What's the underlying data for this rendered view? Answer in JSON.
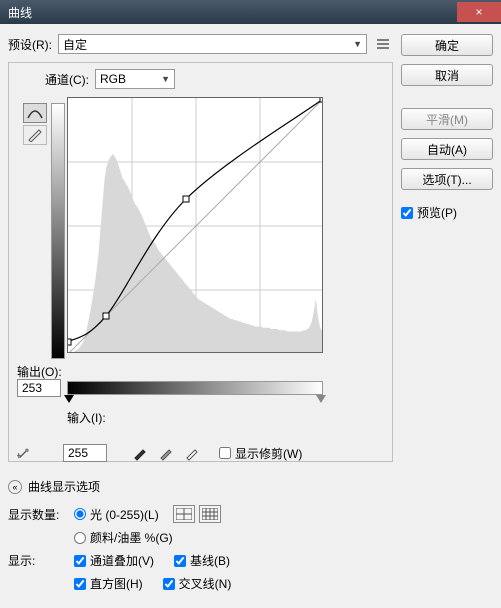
{
  "window": {
    "title": "曲线",
    "close_glyph": "×"
  },
  "buttons": {
    "ok": "确定",
    "cancel": "取消",
    "smooth": "平滑(M)",
    "auto": "自动(A)",
    "options": "选项(T)..."
  },
  "preview": {
    "label": "预览(P)",
    "checked": true
  },
  "preset": {
    "label": "预设(R):",
    "value": "自定"
  },
  "channel": {
    "label": "通道(C):",
    "value": "RGB"
  },
  "output": {
    "label": "输出(O):",
    "value": "253"
  },
  "input": {
    "label": "输入(I):",
    "value": "255"
  },
  "show_clipping": {
    "label": "显示修剪(W)",
    "checked": false
  },
  "disclosure": {
    "label": "曲线显示选项",
    "glyph": "⌃"
  },
  "display_amount": {
    "label": "显示数量:",
    "opt_light": "光 (0-255)(L)",
    "opt_pigment": "颜料/油墨 %(G)",
    "selected": "light"
  },
  "show": {
    "label": "显示:",
    "overlay": {
      "label": "通道叠加(V)",
      "checked": true
    },
    "baseline": {
      "label": "基线(B)",
      "checked": true
    },
    "histogram": {
      "label": "直方图(H)",
      "checked": true
    },
    "intersection": {
      "label": "交叉线(N)",
      "checked": true
    }
  },
  "chart_data": {
    "type": "line",
    "title": "",
    "xlabel": "输入",
    "ylabel": "输出",
    "xlim": [
      0,
      255
    ],
    "ylim": [
      0,
      255
    ],
    "grid": true,
    "series": [
      {
        "name": "curve",
        "points": [
          [
            0,
            12
          ],
          [
            38,
            38
          ],
          [
            118,
            155
          ],
          [
            255,
            255
          ]
        ]
      },
      {
        "name": "baseline",
        "points": [
          [
            0,
            0
          ],
          [
            255,
            255
          ]
        ]
      }
    ],
    "control_points": [
      [
        0,
        12
      ],
      [
        38,
        38
      ],
      [
        118,
        155
      ],
      [
        255,
        255
      ]
    ],
    "histogram": [
      0,
      0,
      1,
      2,
      3,
      4,
      6,
      8,
      12,
      18,
      26,
      34,
      44,
      54,
      66,
      80,
      100,
      120,
      140,
      150,
      155,
      158,
      160,
      158,
      155,
      150,
      145,
      140,
      138,
      135,
      132,
      128,
      124,
      120,
      118,
      115,
      112,
      108,
      104,
      100,
      96,
      92,
      90,
      88,
      85,
      82,
      80,
      78,
      76,
      74,
      72,
      70,
      68,
      66,
      64,
      62,
      60,
      58,
      56,
      54,
      52,
      50,
      48,
      46,
      44,
      43,
      42,
      41,
      40,
      39,
      38,
      37,
      36,
      35,
      34,
      33,
      32,
      31,
      30,
      29,
      28,
      28,
      27,
      27,
      26,
      26,
      25,
      25,
      24,
      24,
      23,
      23,
      22,
      22,
      22,
      22,
      21,
      21,
      21,
      21,
      20,
      20,
      20,
      20,
      19,
      19,
      19,
      19,
      18,
      18,
      18,
      18,
      18,
      18,
      18,
      18,
      19,
      19,
      20,
      22,
      26,
      34,
      44,
      30,
      22,
      18,
      16
    ]
  }
}
